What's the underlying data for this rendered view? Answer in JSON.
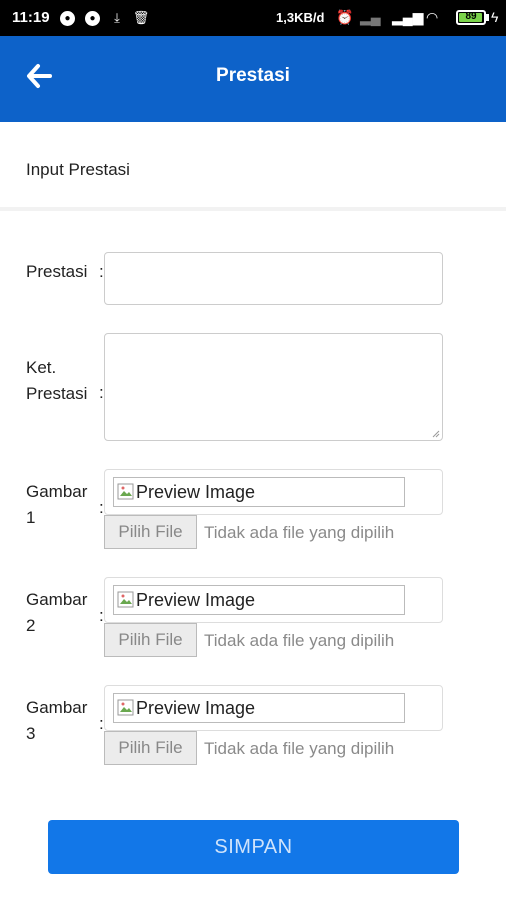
{
  "status_bar": {
    "time": "11:19",
    "network_speed": "1,3KB/d",
    "battery_level": "89",
    "notification_icons": [
      "chrome-icon",
      "chrome-icon",
      "download-icon",
      "trash-icon"
    ],
    "status_icons": [
      "alarm-icon",
      "signal-icon",
      "signal-4g-icon",
      "wifi-icon",
      "battery-icon",
      "charging-icon"
    ]
  },
  "app_bar": {
    "title": "Prestasi",
    "back_icon": "arrow-left-icon",
    "color": "#0d62c9"
  },
  "section": {
    "title": "Input Prestasi"
  },
  "form": {
    "colon": ":",
    "prestasi_label": "Prestasi",
    "prestasi_value": "",
    "ket_label_line1": "Ket.",
    "ket_label_line2": "Prestasi",
    "ket_value": "",
    "images": [
      {
        "label_line1": "Gambar",
        "label_line2": "1",
        "preview_alt": "Preview Image",
        "file_button": "Pilih File",
        "file_status": "Tidak ada file yang dipilih"
      },
      {
        "label_line1": "Gambar",
        "label_line2": "2",
        "preview_alt": "Preview Image",
        "file_button": "Pilih File",
        "file_status": "Tidak ada file yang dipilih"
      },
      {
        "label_line1": "Gambar",
        "label_line2": "3",
        "preview_alt": "Preview Image",
        "file_button": "Pilih File",
        "file_status": "Tidak ada file yang dipilih"
      }
    ]
  },
  "submit": {
    "label": "SIMPAN",
    "color": "#1277e8"
  }
}
